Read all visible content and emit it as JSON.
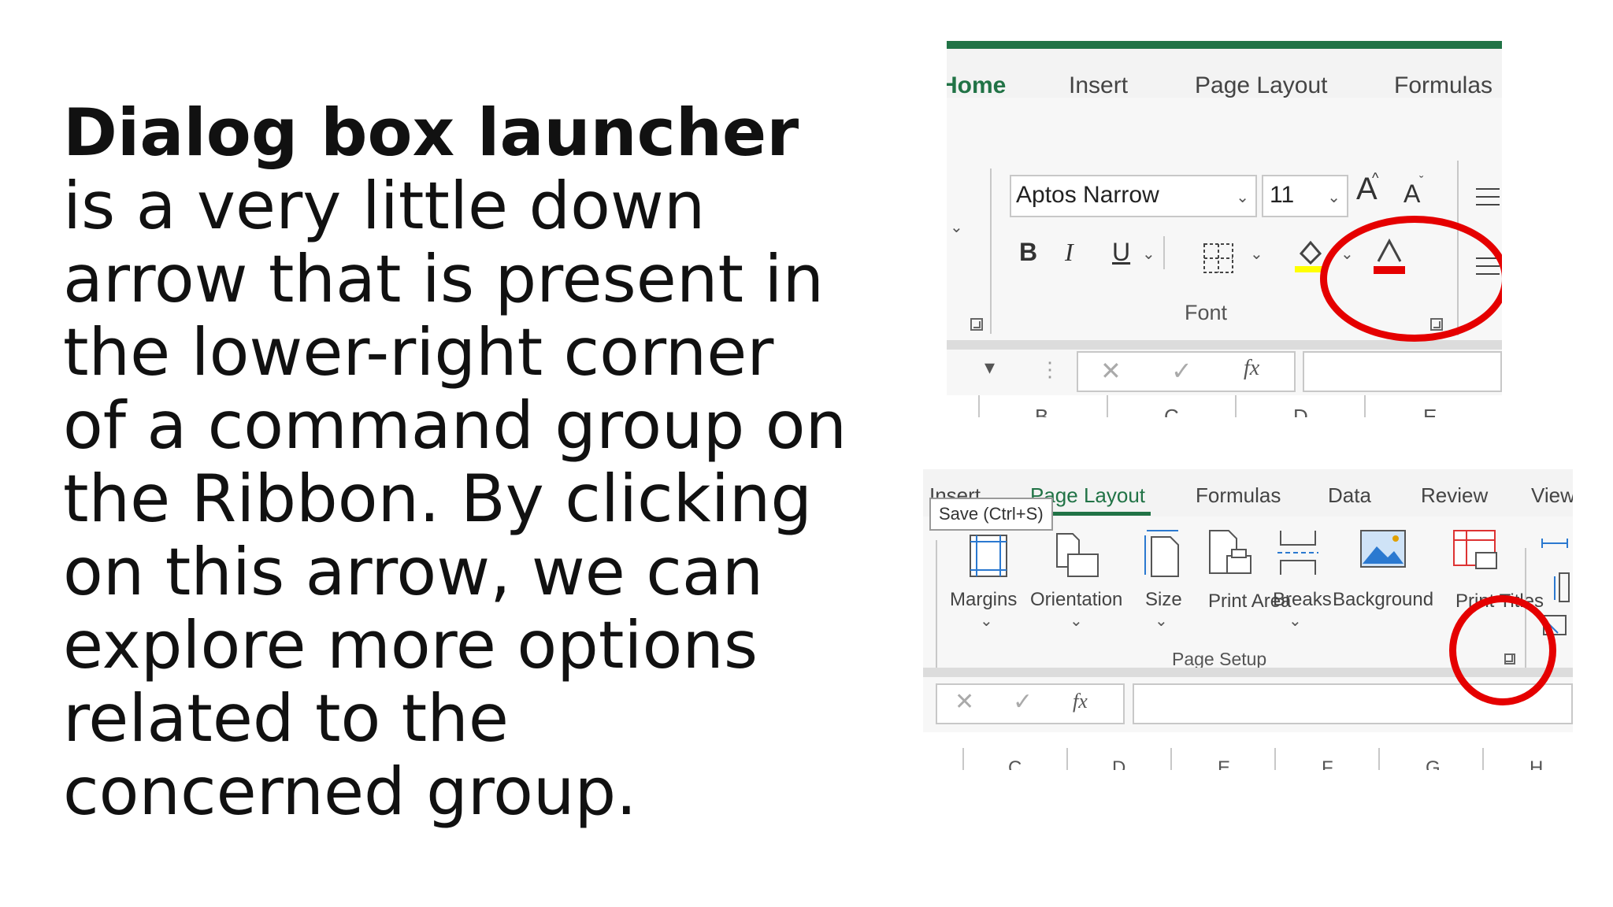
{
  "slide": {
    "bold_term": "Dialog box launcher",
    "body_text": " is a very little down arrow that is present in the lower-right corner of a command group on the Ribbon. By clicking on this arrow, we can explore more options related to the concerned group."
  },
  "shot1": {
    "tabs": [
      "Home",
      "Insert",
      "Page Layout",
      "Formulas"
    ],
    "active_tab": "Home",
    "font_name": "Aptos Narrow",
    "font_size": "11",
    "grow_font": "A",
    "shrink_font": "A",
    "bold": "B",
    "italic": "I",
    "underline": "U",
    "group_label": "Font",
    "fx": "fx",
    "columns": [
      "B",
      "C",
      "D",
      "E"
    ],
    "accent_color": "#217346",
    "highlight_color": "#e50000"
  },
  "shot2": {
    "tabs": [
      "Insert",
      "Page Layout",
      "Formulas",
      "Data",
      "Review",
      "View"
    ],
    "active_tab": "Page Layout",
    "tooltip": "Save (Ctrl+S)",
    "commands": [
      {
        "label": "Margins"
      },
      {
        "label": "Orientation"
      },
      {
        "label": "Size"
      },
      {
        "label": "Print Area"
      },
      {
        "label": "Breaks"
      },
      {
        "label": "Background"
      },
      {
        "label": "Print Titles"
      }
    ],
    "group_label": "Page Setup",
    "fx": "fx",
    "columns": [
      "C",
      "D",
      "E",
      "F",
      "G",
      "H"
    ]
  }
}
